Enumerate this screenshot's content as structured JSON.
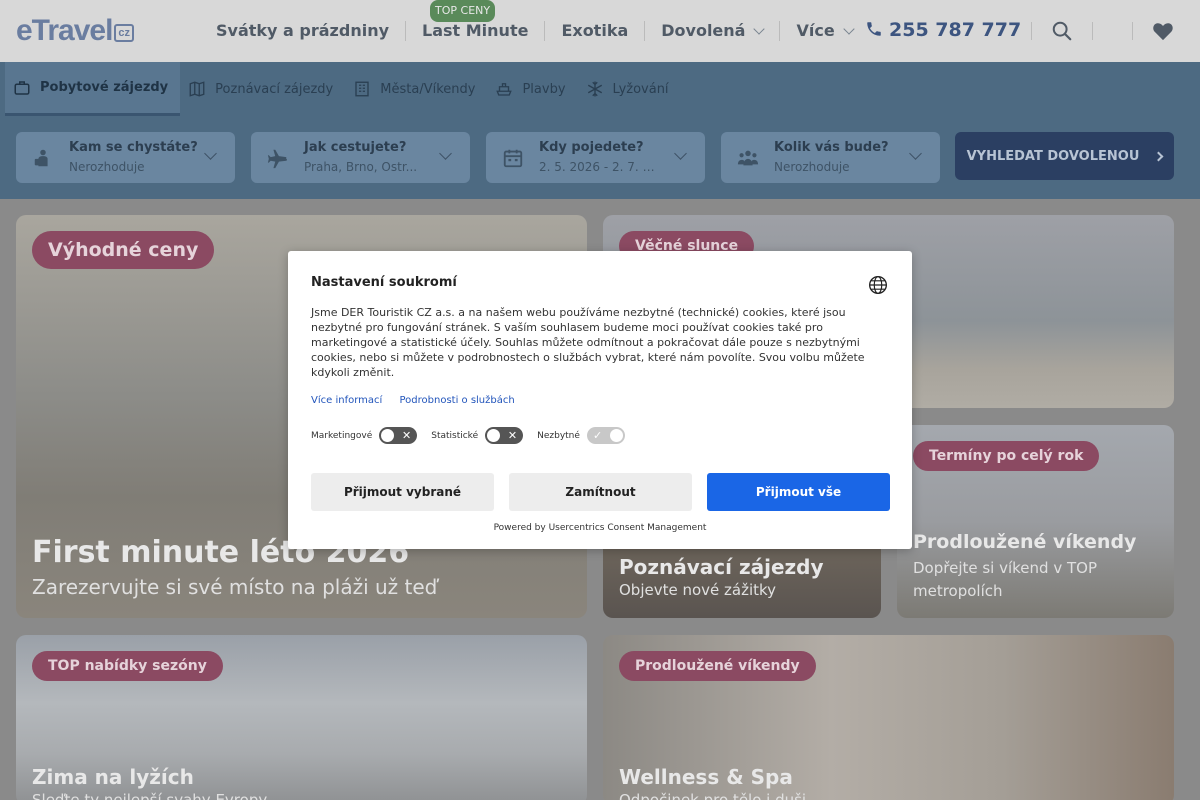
{
  "header": {
    "logo": "eTravel",
    "logo_suffix": "cz",
    "nav": [
      {
        "label": "Svátky a prázdniny",
        "chevron": false
      },
      {
        "label": "Last Minute",
        "chevron": false,
        "badge": "TOP CENY"
      },
      {
        "label": "Exotika",
        "chevron": false
      },
      {
        "label": "Dovolená",
        "chevron": true
      },
      {
        "label": "Více",
        "chevron": true
      }
    ],
    "phone": "255 787 777"
  },
  "tabs": [
    {
      "label": "Pobytové zájezdy",
      "icon": "suitcase-icon",
      "active": true
    },
    {
      "label": "Poznávací zájezdy",
      "icon": "map-icon",
      "active": false
    },
    {
      "label": "Města/Víkendy",
      "icon": "building-icon",
      "active": false
    },
    {
      "label": "Plavby",
      "icon": "ship-icon",
      "active": false
    },
    {
      "label": "Lyžování",
      "icon": "snowflake-icon",
      "active": false
    }
  ],
  "search": {
    "fields": [
      {
        "label": "Kam se chystáte?",
        "value": "Nerozhoduje",
        "icon": "traveler-icon"
      },
      {
        "label": "Jak cestujete?",
        "value": "Praha, Brno, Ostr...",
        "icon": "plane-icon"
      },
      {
        "label": "Kdy pojedete?",
        "value": "2. 5. 2026 - 2. 7. 2...",
        "icon": "calendar-icon"
      },
      {
        "label": "Kolik vás bude?",
        "value": "Nerozhoduje",
        "icon": "people-icon"
      }
    ],
    "button": "VYHLEDAT DOVOLENOU"
  },
  "cards": [
    {
      "badge": "Výhodné ceny",
      "title": "First minute léto 2026",
      "subtitle": "Zarezervujte si své místo na pláži už teď"
    },
    {
      "badge": "Věčné slunce",
      "title": "",
      "subtitle": ""
    },
    {
      "badge": "",
      "title": "Poznávací zájezdy",
      "subtitle": "Objevte nové zážitky"
    },
    {
      "badge": "Termíny po celý rok",
      "title": "Prodloužené víkendy",
      "subtitle": "Dopřejte si víkend v TOP metropolích"
    },
    {
      "badge": "TOP nabídky sezóny",
      "title": "Zima na lyžích",
      "subtitle": "Sleďte ty nejlepší svahy Evropy"
    },
    {
      "badge": "Prodloužené víkendy",
      "title": "Wellness & Spa",
      "subtitle": "Odpočinek pro tělo i duši"
    }
  ],
  "consent": {
    "title": "Nastavení soukromí",
    "text": "Jsme DER Touristik CZ a.s. a na našem webu používáme nezbytné (technické) cookies, které jsou nezbytné pro fungování stránek. S vaším souhlasem budeme moci používat cookies také pro marketingové a statistické účely. Souhlas můžete odmítnout a pokračovat dále pouze s nezbytnými cookies, nebo si můžete v podrobnostech o službách vybrat, které nám povolíte. Svou volbu můžete kdykoli změnit.",
    "link_more": "Více informací",
    "link_services": "Podrobnosti o službách",
    "toggles": [
      {
        "label": "Marketingové",
        "on": false
      },
      {
        "label": "Statistické",
        "on": false
      },
      {
        "label": "Nezbytné",
        "on": true
      }
    ],
    "btn_selected": "Přijmout vybrané",
    "btn_reject": "Zamítnout",
    "btn_accept_all": "Přijmout vše",
    "powered": "Powered by Usercentrics Consent Management",
    "accent_color": "#1a66e6"
  }
}
